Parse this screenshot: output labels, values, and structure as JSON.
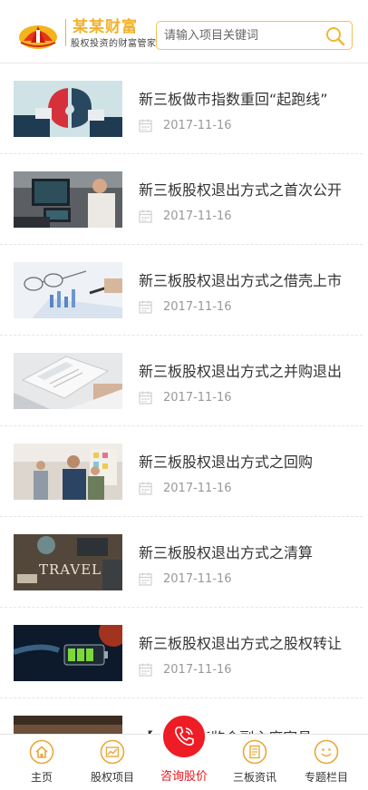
{
  "header": {
    "logo_name": "某某财富",
    "logo_slogan": "股权投资的财富管家",
    "search_placeholder": "请输入项目关键词"
  },
  "articles": [
    {
      "title": "新三板做市指数重回“起跑线”",
      "date": "2017-11-16",
      "thumb": "puzzle"
    },
    {
      "title": "新三板股权退出方式之首次公开",
      "date": "2017-11-16",
      "thumb": "office"
    },
    {
      "title": "新三板股权退出方式之借壳上市",
      "date": "2017-11-16",
      "thumb": "glasses"
    },
    {
      "title": "新三板股权退出方式之并购退出",
      "date": "2017-11-16",
      "thumb": "laptop"
    },
    {
      "title": "新三板股权退出方式之回购",
      "date": "2017-11-16",
      "thumb": "meeting"
    },
    {
      "title": "新三板股权退出方式之清算",
      "date": "2017-11-16",
      "thumb": "travel"
    },
    {
      "title": "新三板股权退出方式之股权转让",
      "date": "2017-11-16",
      "thumb": "battery"
    }
  ],
  "partial_article": {
    "title": "【 … 】 证监会副主席宣昌"
  },
  "tabbar": [
    {
      "label": "主页",
      "icon": "home-icon"
    },
    {
      "label": "股权项目",
      "icon": "chart-icon"
    },
    {
      "label": "咨询股价",
      "icon": "phone-icon"
    },
    {
      "label": "三板资讯",
      "icon": "document-icon"
    },
    {
      "label": "专题栏目",
      "icon": "smile-icon"
    }
  ],
  "colors": {
    "accent": "#f2b12a",
    "tab_icon": "#e9a93a",
    "center_button": "#ee1c24",
    "active_label": "#e8141a"
  }
}
